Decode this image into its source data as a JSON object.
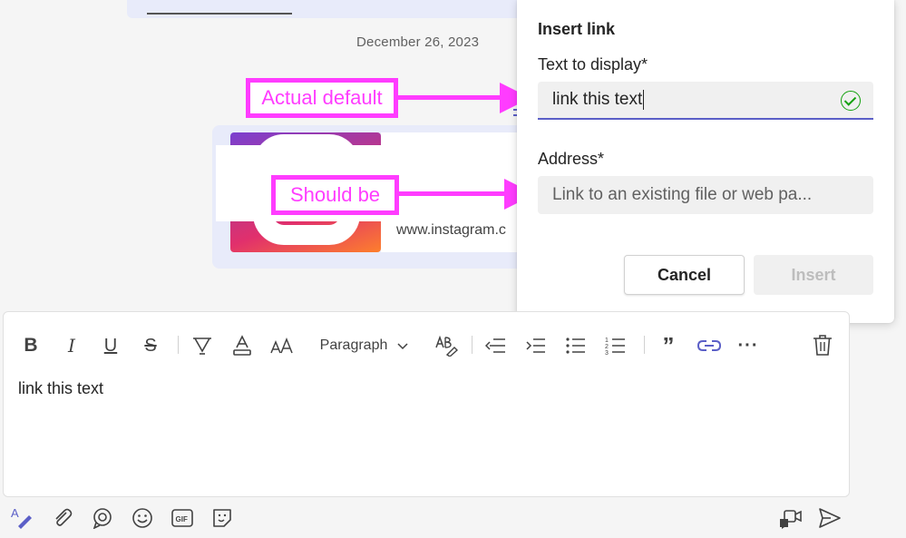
{
  "chat": {
    "date": "December 26, 2023",
    "card_url": "www.instagram.c"
  },
  "annotations": {
    "top": "Actual default",
    "bottom": "Should be"
  },
  "dialog": {
    "title": "Insert link",
    "display_label": "Text to display*",
    "display_value": "link this text",
    "address_label": "Address*",
    "address_placeholder": "Link to an existing file or web pa...",
    "cancel": "Cancel",
    "insert": "Insert"
  },
  "toolbar": {
    "paragraph": "Paragraph",
    "icons": [
      "bold-icon",
      "italic-icon",
      "underline-icon",
      "strikethrough-icon",
      "highlight-icon",
      "font-color-icon",
      "font-size-icon",
      "paragraph-dropdown",
      "format-painter-icon",
      "decrease-indent-icon",
      "increase-indent-icon",
      "bulleted-list-icon",
      "numbered-list-icon",
      "quote-icon",
      "link-icon",
      "more-options-icon",
      "delete-icon"
    ]
  },
  "editor": {
    "text": "link this text"
  },
  "bottom_actions": [
    "format-icon",
    "attach-icon",
    "loop-icon",
    "emoji-icon",
    "gif-icon",
    "sticker-icon",
    "meet-now-icon",
    "send-icon"
  ],
  "colors": {
    "accent": "#5b5fc7",
    "annotation": "#ff3cff",
    "success": "#13a10e"
  }
}
